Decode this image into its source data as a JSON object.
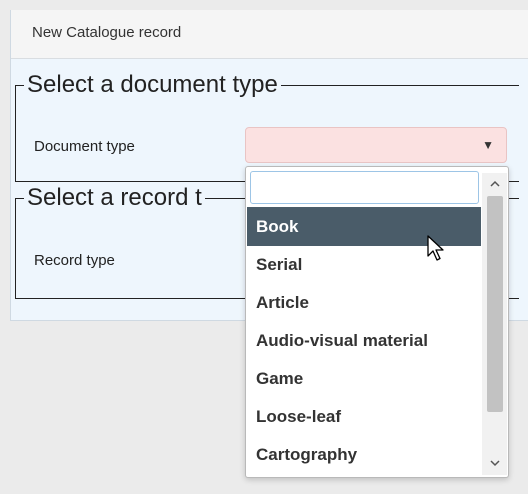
{
  "panel": {
    "title": "New Catalogue record"
  },
  "document_group": {
    "legend": "Select a document type",
    "field_label": "Document type",
    "selected_value": ""
  },
  "record_group": {
    "legend": "Select a record t",
    "field_label": "Record type"
  },
  "dropdown": {
    "search_value": "",
    "highlighted_index": 0,
    "options": [
      "Book",
      "Serial",
      "Article",
      "Audio-visual material",
      "Game",
      "Loose-leaf",
      "Cartography"
    ]
  },
  "colors": {
    "panel_bg": "#eef6fd",
    "invalid_select_bg": "#fbe1e1",
    "highlight_bg": "#4a5c69",
    "search_border": "#9dc5e6"
  },
  "icons": {
    "select_caret": "caret-down-icon",
    "scroll_up": "scroll-up-arrow-icon",
    "scroll_down": "scroll-down-arrow-icon",
    "cursor": "mouse-pointer-icon"
  }
}
